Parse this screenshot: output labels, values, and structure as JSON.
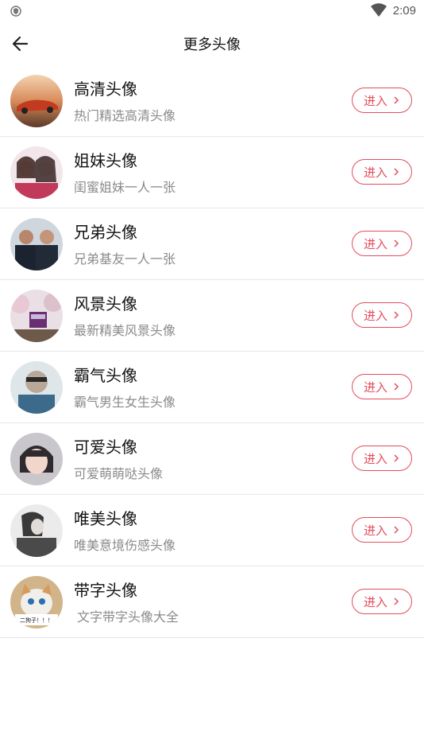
{
  "status": {
    "time": "2:09"
  },
  "header": {
    "title": "更多头像",
    "back_icon": "back-arrow-icon"
  },
  "colors": {
    "accent": "#e44d5b",
    "text": "#111111",
    "muted": "#8a8a8a",
    "divider": "#e6e6e6"
  },
  "items": [
    {
      "name": "高清头像",
      "desc": "热门精选高清头像",
      "button": "进入"
    },
    {
      "name": "姐妹头像",
      "desc": "闺蜜姐妹一人一张",
      "button": "进入"
    },
    {
      "name": "兄弟头像",
      "desc": "兄弟基友一人一张",
      "button": "进入"
    },
    {
      "name": "风景头像",
      "desc": "最新精美风景头像",
      "button": "进入"
    },
    {
      "name": "霸气头像",
      "desc": "霸气男生女生头像",
      "button": "进入"
    },
    {
      "name": "可爱头像",
      "desc": "可爱萌萌哒头像",
      "button": "进入"
    },
    {
      "name": "唯美头像",
      "desc": "唯美意境伤感头像",
      "button": "进入"
    },
    {
      "name": "带字头像",
      "desc": "文字带字头像大全",
      "button": "进入",
      "avatar_text": "二狗子！！！"
    }
  ]
}
